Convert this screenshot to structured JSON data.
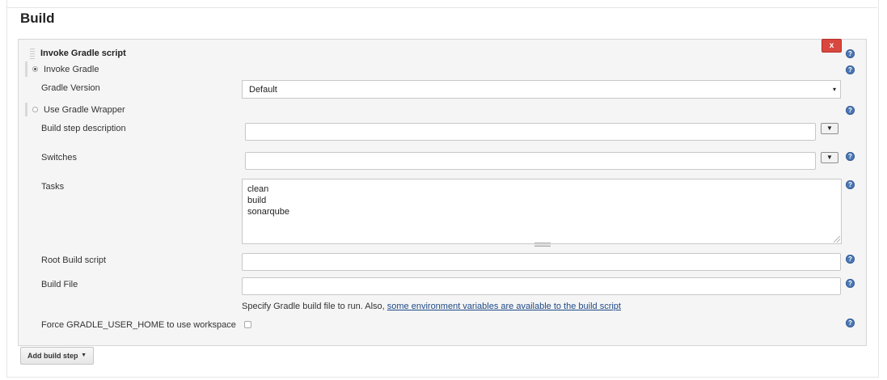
{
  "section": {
    "title": "Build"
  },
  "step": {
    "title": "Invoke Gradle script",
    "delete_label": "x",
    "help_glyph": "?"
  },
  "invoke_gradle": {
    "label": "Invoke Gradle",
    "selected": true,
    "version_label": "Gradle Version",
    "version_value": "Default",
    "version_arrow": "▾"
  },
  "wrapper": {
    "label": "Use Gradle Wrapper",
    "selected": false
  },
  "fields": {
    "description_label": "Build step description",
    "description_value": "",
    "switches_label": "Switches",
    "switches_value": "",
    "expand_arrow": "▼",
    "tasks_label": "Tasks",
    "tasks_value": "clean\nbuild\nsonarqube",
    "root_script_label": "Root Build script",
    "root_script_value": "",
    "build_file_label": "Build File",
    "build_file_value": "",
    "build_file_hint": "Specify Gradle build file to run. Also, ",
    "build_file_hint_link": "some environment variables are available to the build script",
    "force_home_label": "Force GRADLE_USER_HOME to use workspace",
    "force_home_checked": false
  },
  "footer": {
    "add_step_label": "Add build step",
    "add_step_caret": "▼"
  },
  "colors": {
    "help_icon": "#4b78b5",
    "delete_button": "#d9473f",
    "link": "#204a87"
  }
}
